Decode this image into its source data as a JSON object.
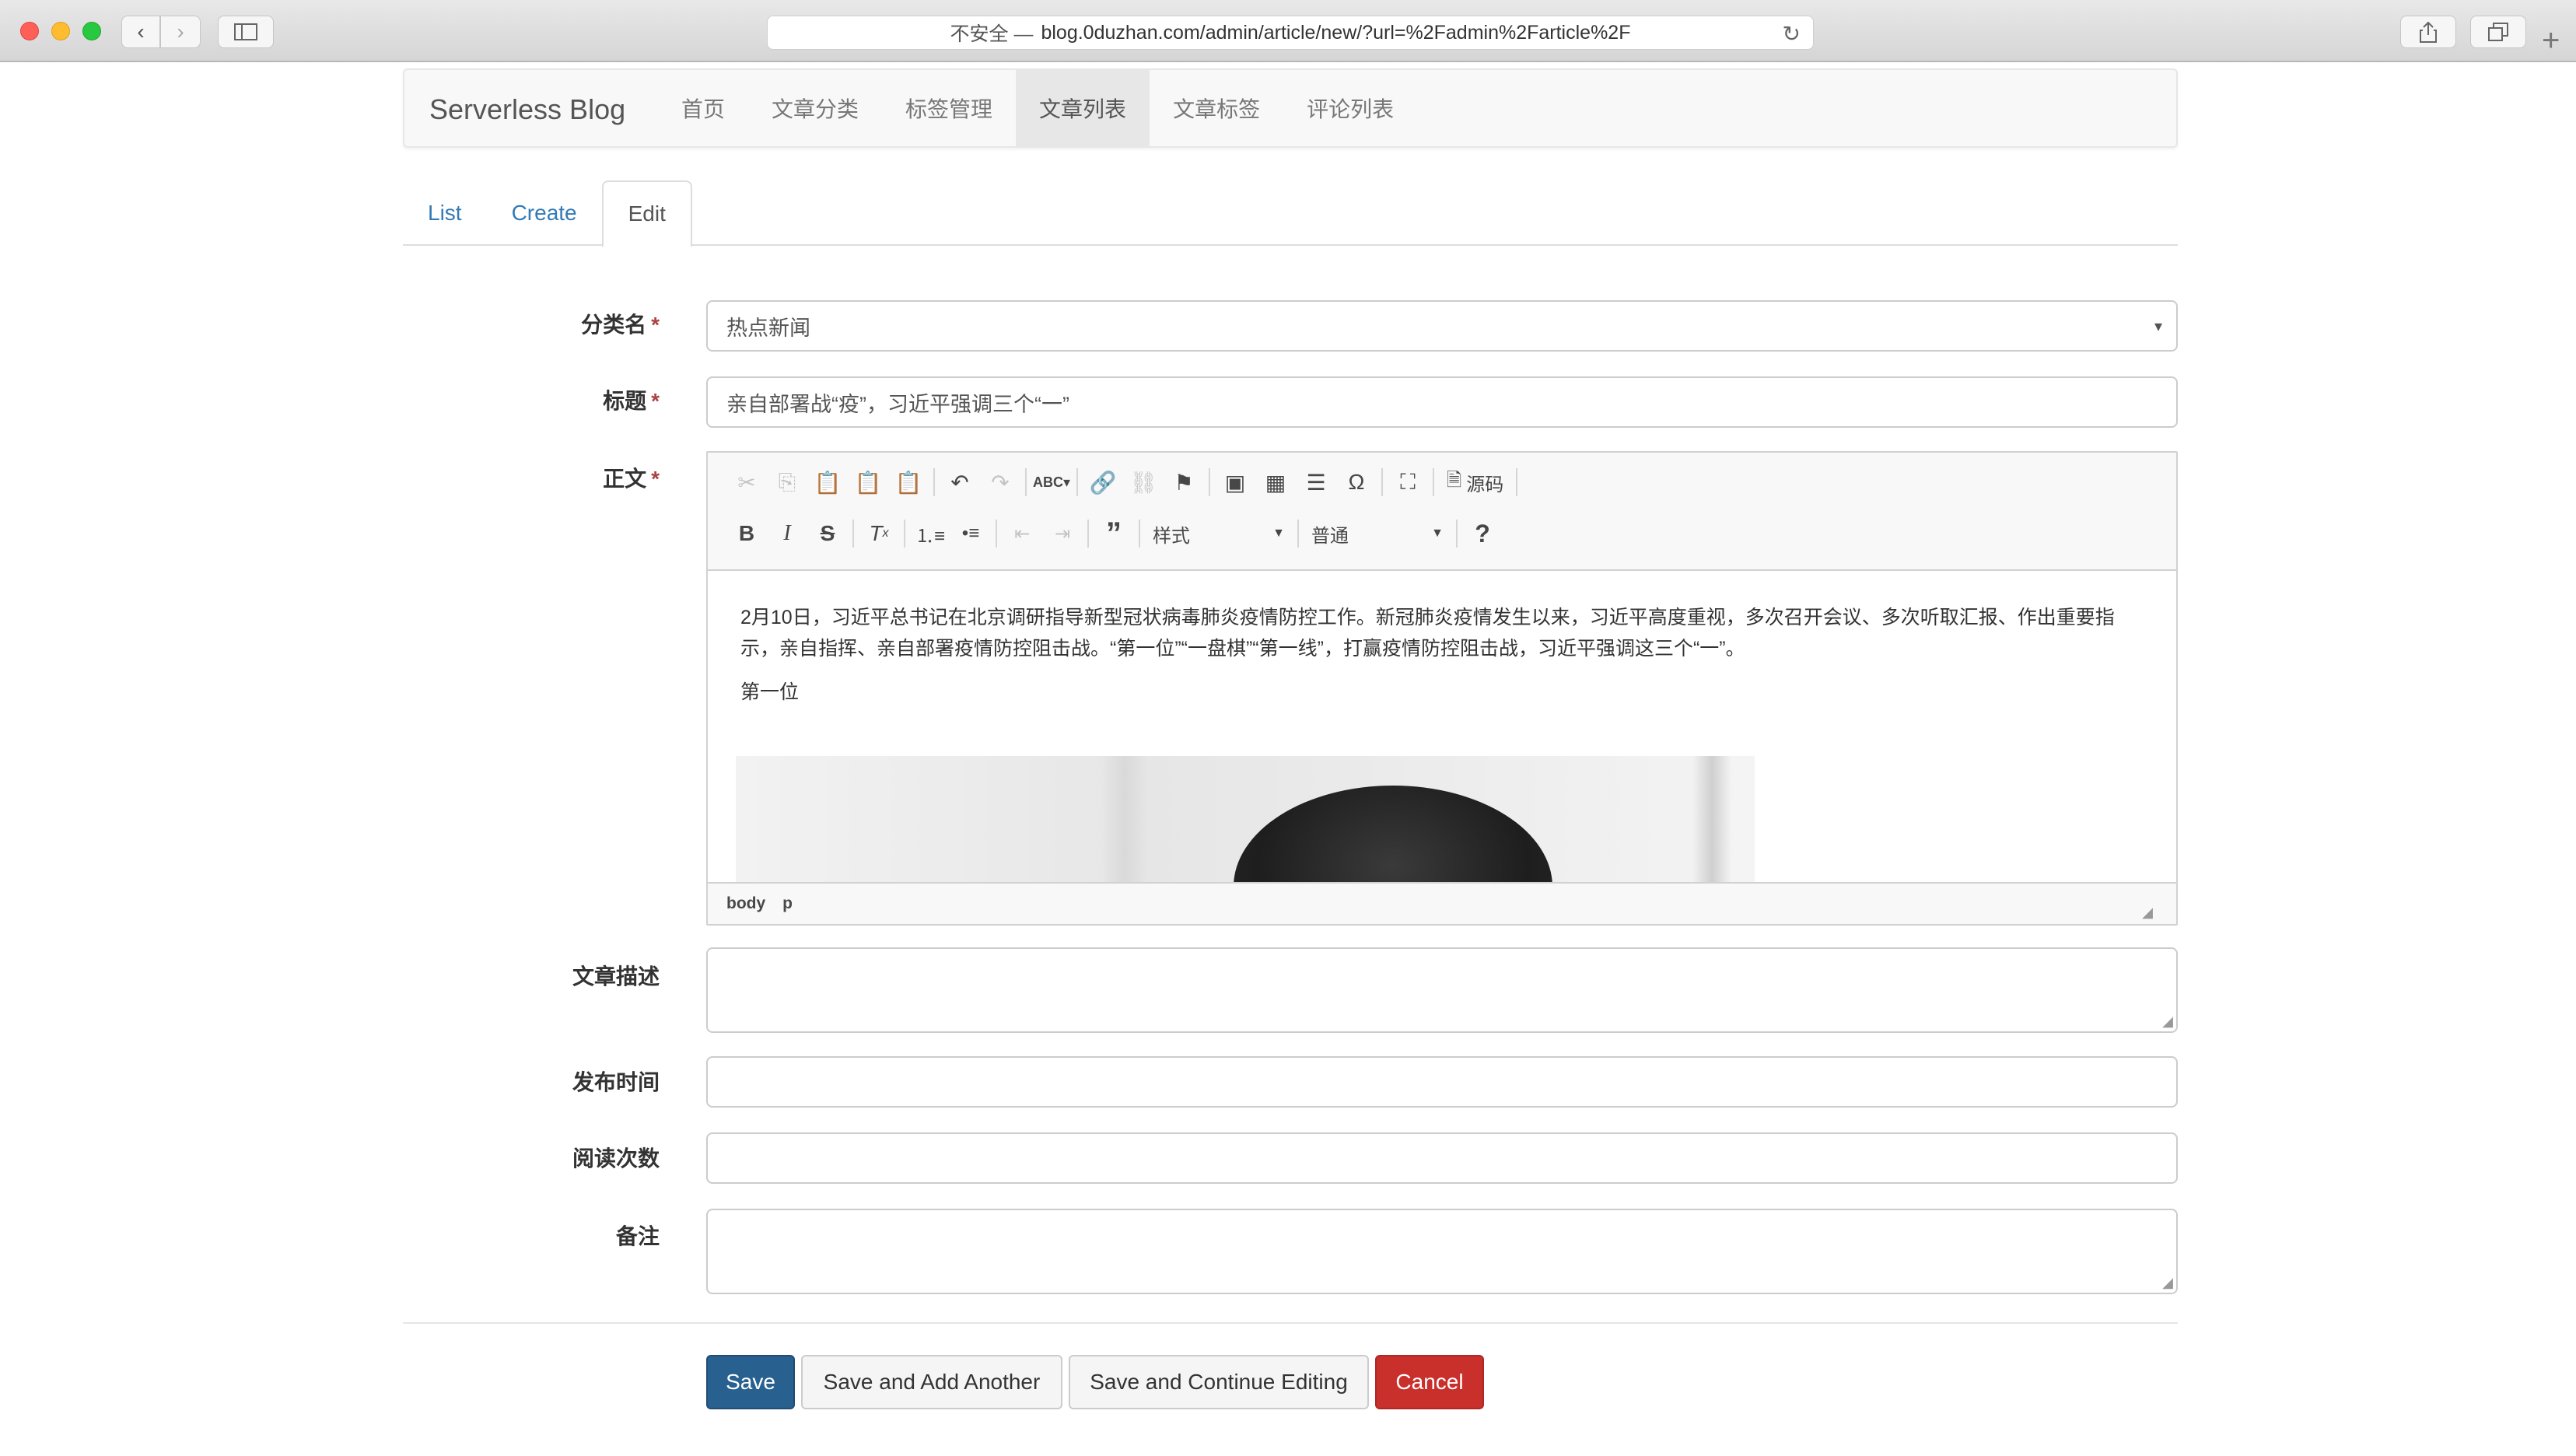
{
  "browser": {
    "insecure_label": "不安全 —",
    "url": "blog.0duzhan.com/admin/article/new/?url=%2Fadmin%2Farticle%2F"
  },
  "navbar": {
    "brand": "Serverless Blog",
    "links": [
      "首页",
      "文章分类",
      "标签管理",
      "文章列表",
      "文章标签",
      "评论列表"
    ],
    "active": "文章列表"
  },
  "form_tabs": {
    "list": "List",
    "create": "Create",
    "edit": "Edit",
    "active": "Edit"
  },
  "form": {
    "category": {
      "label": "分类名",
      "value": "热点新闻"
    },
    "title": {
      "label": "标题",
      "value": "亲自部署战“疫”，习近平强调三个“一”"
    },
    "body": {
      "label": "正文",
      "paragraph1": "2月10日，习近平总书记在北京调研指导新型冠状病毒肺炎疫情防控工作。新冠肺炎疫情发生以来，习近平高度重视，多次召开会议、多次听取汇报、作出重要指示，亲自指挥、亲自部署疫情防控阻击战。“第一位”“一盘棋”“第一线”，打赢疫情防控阻击战，习近平强调这三个“一”。",
      "paragraph2": "第一位",
      "toolbar": {
        "source_label": "源码",
        "style_combo": "样式",
        "format_combo": "普通"
      },
      "path": [
        "body",
        "p"
      ]
    },
    "description": {
      "label": "文章描述",
      "value": ""
    },
    "publish_time": {
      "label": "发布时间",
      "value": ""
    },
    "read_count": {
      "label": "阅读次数",
      "value": ""
    },
    "remark": {
      "label": "备注",
      "value": ""
    },
    "required_mark": "*"
  },
  "actions": {
    "save": "Save",
    "save_add": "Save and Add Another",
    "save_continue": "Save and Continue Editing",
    "cancel": "Cancel"
  },
  "colors": {
    "primary": "#286090",
    "danger": "#c9302c",
    "link": "#337ab7"
  }
}
